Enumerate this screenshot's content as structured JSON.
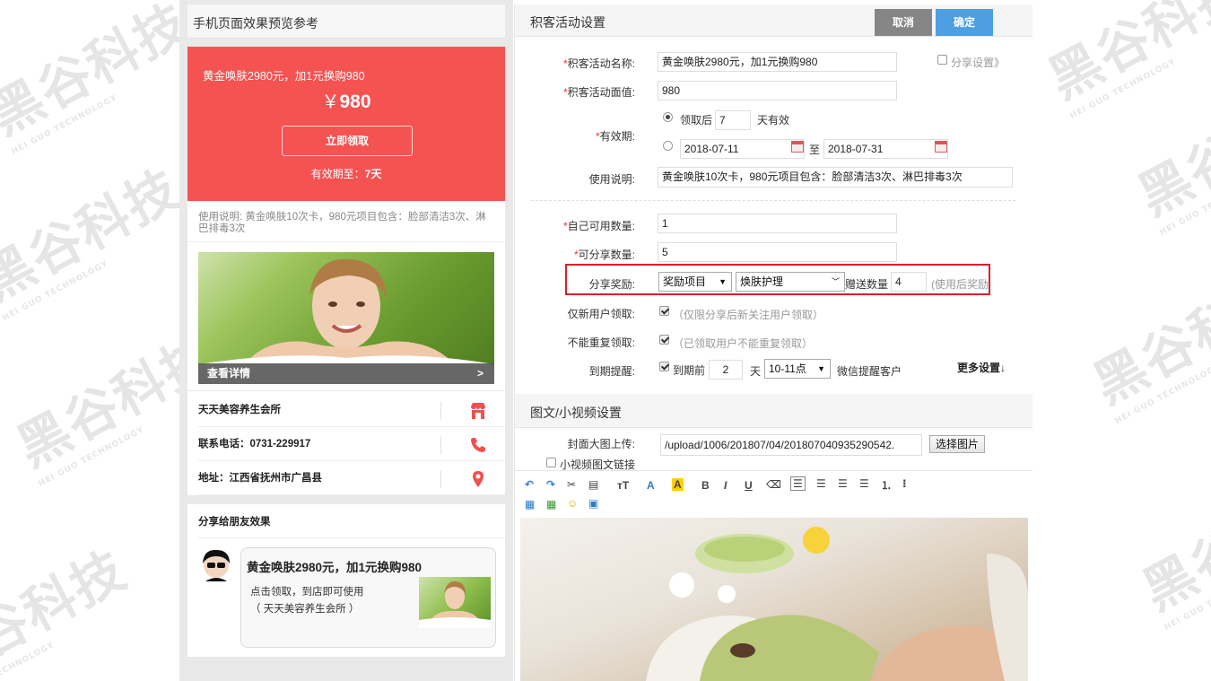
{
  "watermark": {
    "text": "黑谷科技",
    "sub": "HEI GUO TECHNOLOGY"
  },
  "preview": {
    "title": "手机页面效果预览参考",
    "coupon": {
      "name": "黄金唤肤2980元，加1元换购980",
      "currency": "￥",
      "price": "980",
      "claim_button": "立即领取",
      "valid_label": "有效期至：",
      "valid_value": "7天"
    },
    "description": "使用说明: 黄金唤肤10次卡，980元项目包含：脸部清洁3次、淋巴排毒3次",
    "photo_caption": "查看详情",
    "photo_arrow": ">",
    "store_name": "天天美容养生会所",
    "phone": "联系电话：0731-229917",
    "address": "地址：江西省抚州市广昌县",
    "share_title": "分享给朋友效果",
    "share_card": {
      "title": "黄金唤肤2980元，加1元换购980",
      "line1": "点击领取，到店即可使用",
      "line2": "（ 天天美容养生会所 ）"
    }
  },
  "settings": {
    "title": "积客活动设置",
    "cancel": "取消",
    "confirm": "确定",
    "activity_name_label": "积客活动名称:",
    "activity_name": "黄金唤肤2980元，加1元换购980",
    "share_settings": "分享设置》",
    "face_value_label": "积客活动面值:",
    "face_value": "980",
    "validity_label": "有效期:",
    "validity_after": "领取后",
    "validity_days": "7",
    "validity_days_unit": "天有效",
    "date_start": "2018-07-11",
    "date_to": "至",
    "date_end": "2018-07-31",
    "usage_label": "使用说明:",
    "usage": "黄金唤肤10次卡，980元项目包含：脸部清洁3次、淋巴排毒3次",
    "self_qty_label": "自己可用数量:",
    "self_qty": "1",
    "share_qty_label": "可分享数量:",
    "share_qty": "5",
    "reward_label": "分享奖励:",
    "reward_type": "奖励项目",
    "reward_item": "焕肤护理",
    "gift_qty_label": "赠送数量",
    "gift_qty": "4",
    "gift_hint": "(使用后奖励",
    "new_user_label": "仅新用户领取:",
    "new_user_hint": "（仅限分享后新关注用户领取）",
    "no_repeat_label": "不能重复领取:",
    "no_repeat_hint": "（已领取用户不能重复领取）",
    "reminder_label": "到期提醒:",
    "reminder_before": "到期前",
    "reminder_days": "2",
    "reminder_day_unit": "天",
    "reminder_time": "10-11点",
    "reminder_suffix": "微信提醒客户",
    "more_settings": "更多设置↓"
  },
  "media": {
    "title": "图文/小视频设置",
    "cover_label": "封面大图上传:",
    "cover_path": "/upload/1006/201807/04/201807040935290542.",
    "choose_button": "选择图片",
    "video_link_label": "小视频图文链接"
  },
  "toolbar": {
    "font_size": "тT",
    "font_color": "A",
    "highlight": "A",
    "bold": "B",
    "italic": "I",
    "underline": "U"
  }
}
